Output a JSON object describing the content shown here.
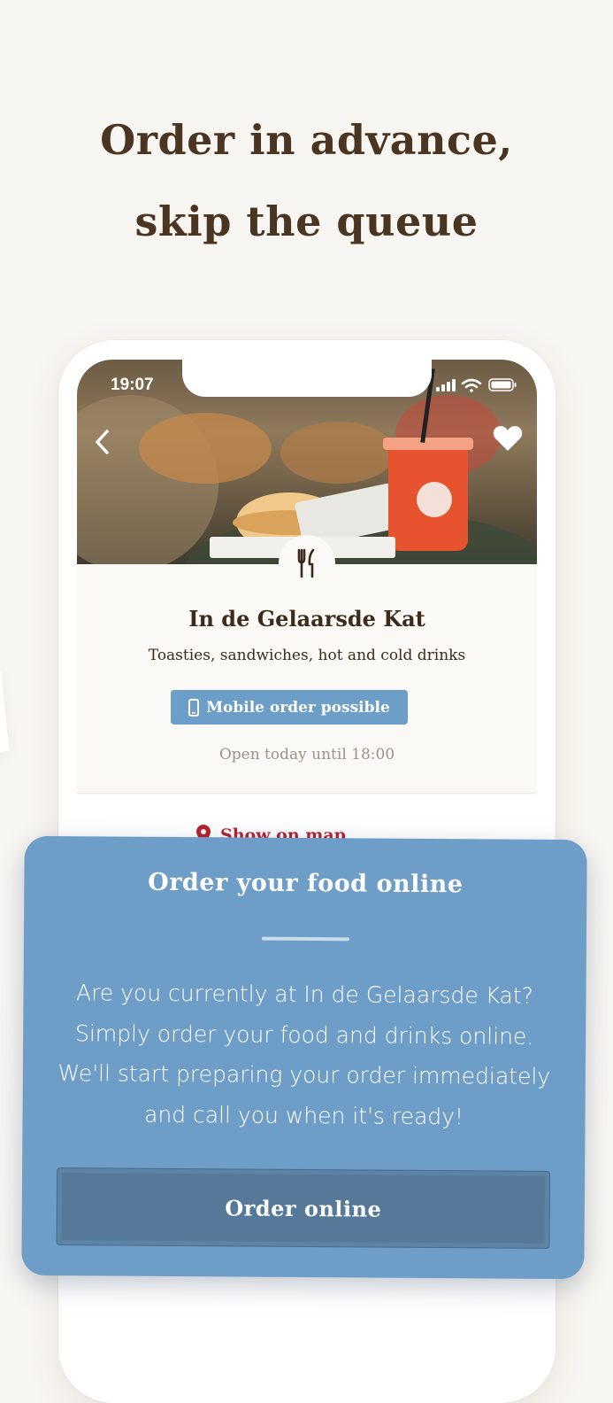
{
  "headline": {
    "line1": "Order in advance,",
    "line2": "skip the queue"
  },
  "status_bar": {
    "time": "19:07",
    "icons": [
      "cellular-signal-icon",
      "wifi-icon",
      "battery-icon"
    ]
  },
  "restaurant": {
    "name": "In de Gelaarsde Kat",
    "description": "Toasties, sandwiches, hot and cold drinks",
    "mobile_order_badge": "Mobile order possible",
    "opening": "Open today until 18:00",
    "map_link": "Show on map"
  },
  "hero_icons": {
    "back": "chevron-left-icon",
    "favorite": "heart-icon",
    "category": "fork-knife-icon"
  },
  "overlay": {
    "title": "Order your food online",
    "body_lines": [
      "Are you currently at In de Gelaarsde Kat?",
      "Simply order your food and drinks online.",
      "We'll start preparing your order immediately",
      "and call you when it's ready!"
    ],
    "button_label": "Order online"
  },
  "colors": {
    "background": "#f8f6f2",
    "headline": "#4a3522",
    "card_blue": "#6e9ec8",
    "button_blue": "#56799a",
    "map_red": "#b8202e"
  }
}
